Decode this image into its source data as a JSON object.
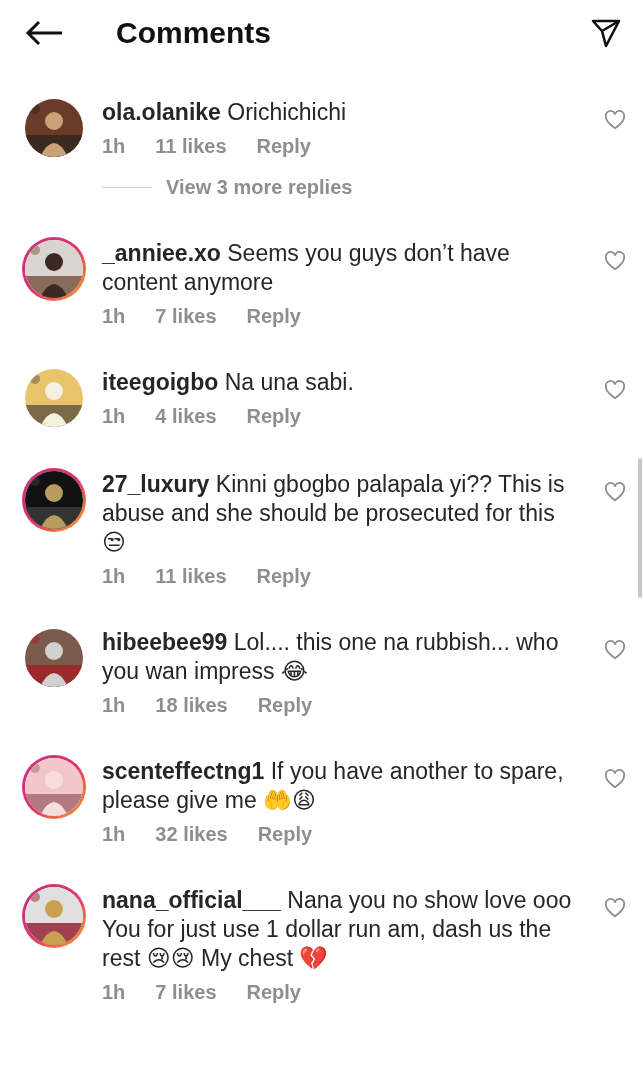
{
  "header": {
    "title": "Comments"
  },
  "comments": [
    {
      "username": "ola.olanike",
      "body": "Orichichichi",
      "time": "1h",
      "likes": "11 likes",
      "reply": "Reply",
      "story_ring": false,
      "liked": false,
      "view_replies": "View 3 more replies"
    },
    {
      "username": "_anniee.xo",
      "body": "Seems you guys don’t have content anymore",
      "time": "1h",
      "likes": "7 likes",
      "reply": "Reply",
      "story_ring": true,
      "liked": false
    },
    {
      "username": "iteegoigbo",
      "body": "Na una sabi.",
      "time": "1h",
      "likes": "4 likes",
      "reply": "Reply",
      "story_ring": false,
      "liked": false
    },
    {
      "username": "27_luxury",
      "body": "Kinni gbogbo palapala yi?? This is abuse and she should be prosecuted for this 😒",
      "time": "1h",
      "likes": "11 likes",
      "reply": "Reply",
      "story_ring": true,
      "liked": false
    },
    {
      "username": "hibeebee99",
      "body": "Lol.... this one na rubbish... who you wan impress 😂",
      "time": "1h",
      "likes": "18 likes",
      "reply": "Reply",
      "story_ring": false,
      "liked": false
    },
    {
      "username": "scenteffectng1",
      "body": "If you have another to spare, please give me 🤲😩",
      "time": "1h",
      "likes": "32 likes",
      "reply": "Reply",
      "story_ring": true,
      "liked": false
    },
    {
      "username": "nana_official___",
      "body": "Nana you no show love ooo\nYou for just use 1 dollar run am, dash us the rest 😢😢 My chest 💔",
      "time": "1h",
      "likes": "7 likes",
      "reply": "Reply",
      "story_ring": true,
      "liked": false
    }
  ]
}
